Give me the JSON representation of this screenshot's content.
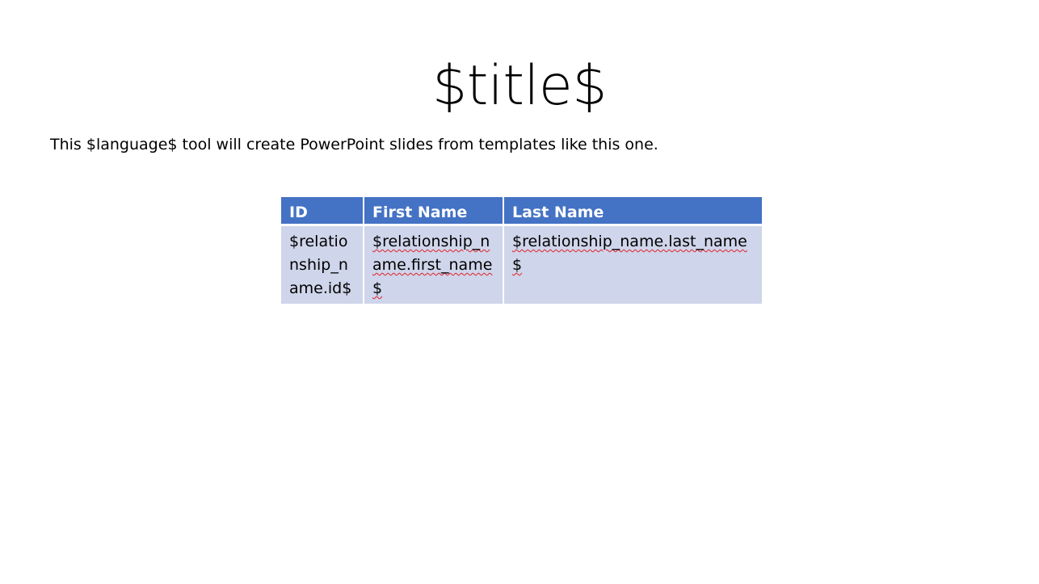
{
  "slide": {
    "title": "$title$",
    "body_text": "This $language$ tool will create PowerPoint slides from templates like this one."
  },
  "table": {
    "headers": [
      "ID",
      "First Name",
      "Last Name"
    ],
    "rows": [
      [
        "$relationship_name.id$",
        "$relationship_name.first_name$",
        "$relationship_name.last_name$"
      ]
    ]
  },
  "colors": {
    "header_fill": "#4472c4",
    "header_text": "#ffffff",
    "cell_fill": "#cfd5ea",
    "spellcheck_underline": "#e0202a"
  }
}
